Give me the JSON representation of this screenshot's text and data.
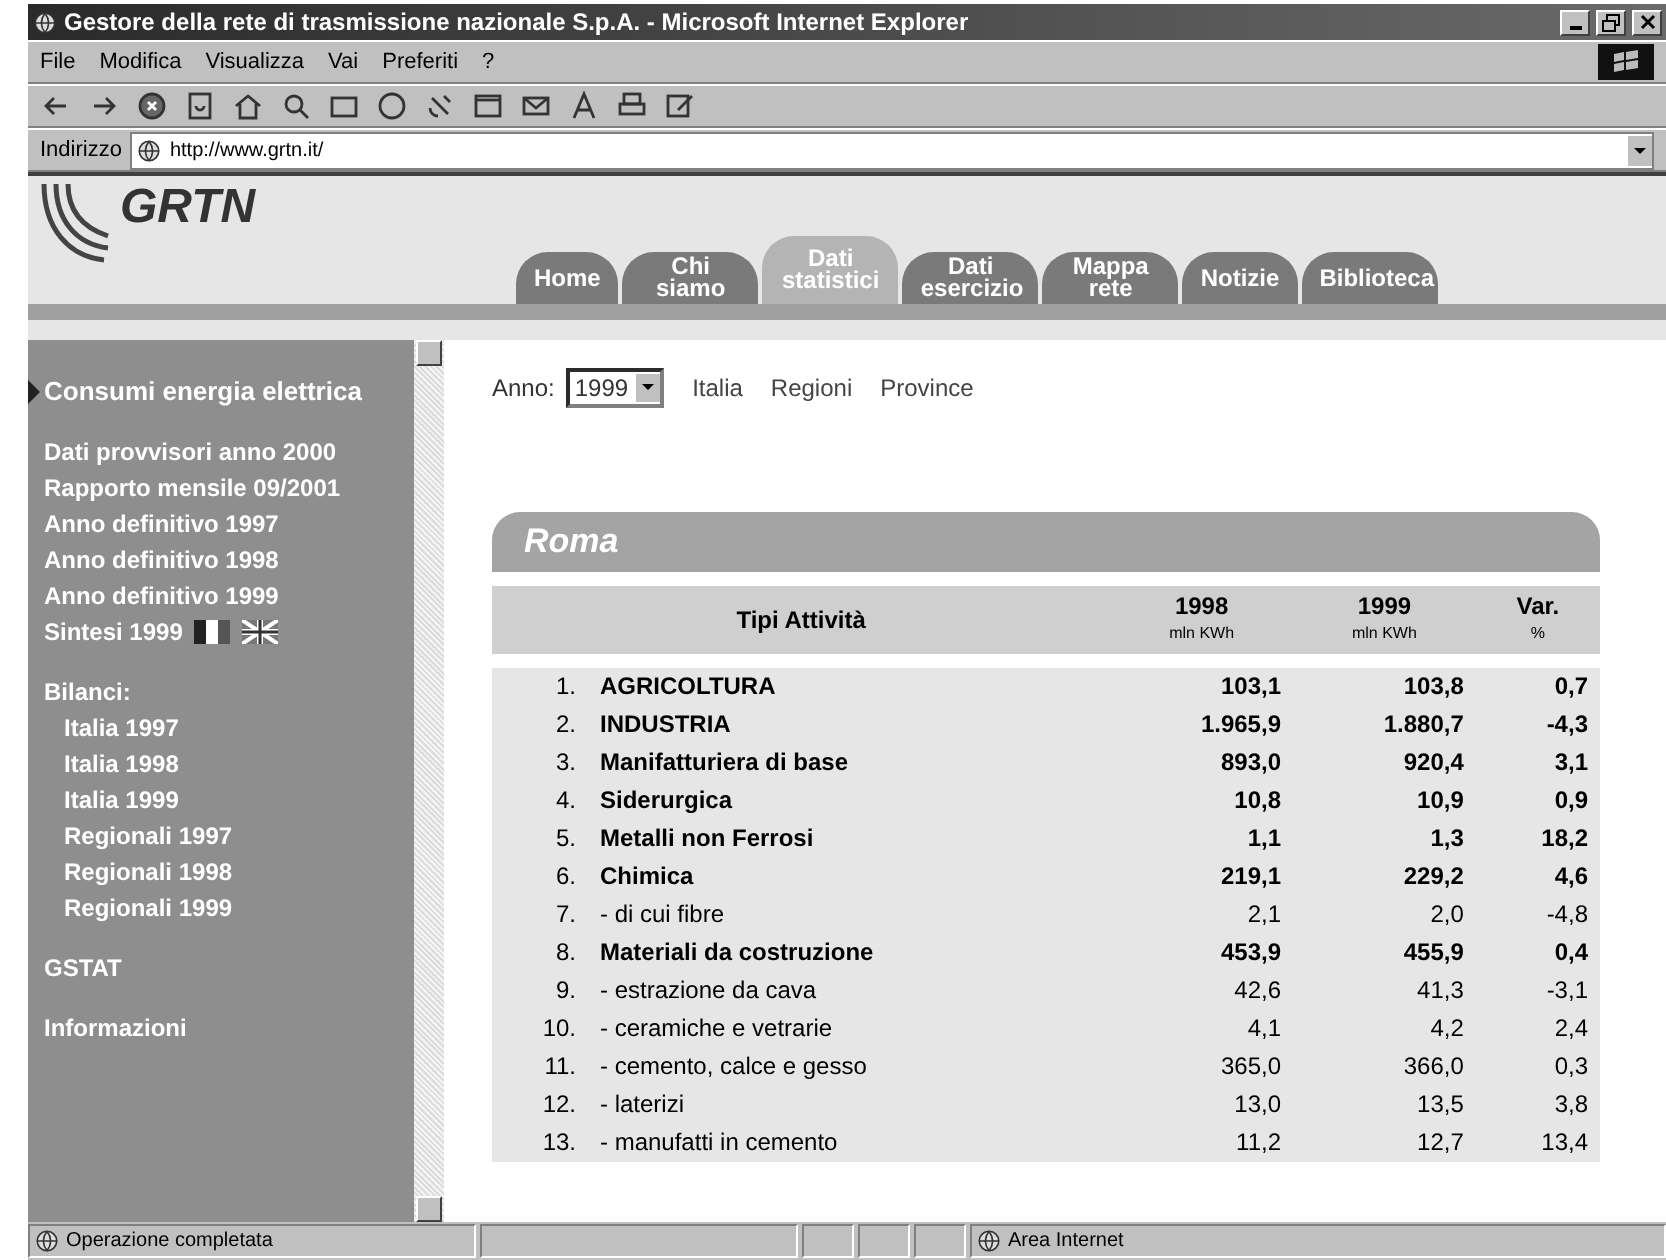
{
  "window": {
    "title": "Gestore della rete di trasmissione nazionale S.p.A. - Microsoft Internet Explorer"
  },
  "menu": [
    "File",
    "Modifica",
    "Visualizza",
    "Vai",
    "Preferiti",
    "?"
  ],
  "address": {
    "label": "Indirizzo",
    "value": "http://www.grtn.it/"
  },
  "site": {
    "logo": "GRTN",
    "tabs": [
      {
        "label": "Home",
        "selected": false
      },
      {
        "label": "Chi siamo",
        "selected": false
      },
      {
        "label": "Dati statistici",
        "selected": true
      },
      {
        "label": "Dati esercizio",
        "selected": false
      },
      {
        "label": "Mappa rete",
        "selected": false
      },
      {
        "label": "Notizie",
        "selected": false
      },
      {
        "label": "Biblioteca",
        "selected": false
      }
    ]
  },
  "sidebar": {
    "groups": [
      {
        "items": [
          {
            "label": "Consumi energia elettrica",
            "selected": true,
            "indented": false
          }
        ]
      },
      {
        "items": [
          {
            "label": "Dati provvisori anno 2000",
            "selected": false,
            "indented": false
          },
          {
            "label": "Rapporto mensile 09/2001",
            "selected": false,
            "indented": false
          },
          {
            "label": "Anno definitivo 1997",
            "selected": false,
            "indented": false
          },
          {
            "label": "Anno definitivo 1998",
            "selected": false,
            "indented": false
          },
          {
            "label": "Anno definitivo 1999",
            "selected": false,
            "indented": false
          },
          {
            "label": "Sintesi 1999",
            "selected": false,
            "indented": false,
            "flags": true
          }
        ]
      },
      {
        "items": [
          {
            "label": "Bilanci:",
            "selected": false,
            "indented": false
          },
          {
            "label": "Italia 1997",
            "selected": false,
            "indented": true
          },
          {
            "label": "Italia 1998",
            "selected": false,
            "indented": true
          },
          {
            "label": "Italia 1999",
            "selected": false,
            "indented": true
          },
          {
            "label": "Regionali 1997",
            "selected": false,
            "indented": true
          },
          {
            "label": "Regionali 1998",
            "selected": false,
            "indented": true
          },
          {
            "label": "Regionali 1999",
            "selected": false,
            "indented": true
          }
        ]
      },
      {
        "items": [
          {
            "label": "GSTAT",
            "selected": false,
            "indented": false
          }
        ]
      },
      {
        "items": [
          {
            "label": "Informazioni",
            "selected": false,
            "indented": false
          }
        ]
      }
    ]
  },
  "filter": {
    "label": "Anno:",
    "year": "1999",
    "links": [
      "Italia",
      "Regioni",
      "Province"
    ]
  },
  "table": {
    "title": "Roma",
    "columns": [
      {
        "label": "Tipi Attività"
      },
      {
        "label": "1998",
        "unit": "mln KWh"
      },
      {
        "label": "1999",
        "unit": "mln KWh"
      },
      {
        "label": "Var.",
        "unit": "%"
      }
    ],
    "rows": [
      {
        "num": "1.",
        "label": "AGRICOLTURA",
        "bold": true,
        "v1998": "103,1",
        "v1999": "103,8",
        "var": "0,7"
      },
      {
        "num": "2.",
        "label": "INDUSTRIA",
        "bold": true,
        "v1998": "1.965,9",
        "v1999": "1.880,7",
        "var": "-4,3"
      },
      {
        "num": "3.",
        "label": "Manifatturiera di base",
        "bold": true,
        "v1998": "893,0",
        "v1999": "920,4",
        "var": "3,1"
      },
      {
        "num": "4.",
        "label": "Siderurgica",
        "bold": true,
        "v1998": "10,8",
        "v1999": "10,9",
        "var": "0,9"
      },
      {
        "num": "5.",
        "label": "Metalli non Ferrosi",
        "bold": true,
        "v1998": "1,1",
        "v1999": "1,3",
        "var": "18,2"
      },
      {
        "num": "6.",
        "label": "Chimica",
        "bold": true,
        "v1998": "219,1",
        "v1999": "229,2",
        "var": "4,6"
      },
      {
        "num": "7.",
        "label": "- di cui fibre",
        "bold": false,
        "v1998": "2,1",
        "v1999": "2,0",
        "var": "-4,8"
      },
      {
        "num": "8.",
        "label": "Materiali da costruzione",
        "bold": true,
        "v1998": "453,9",
        "v1999": "455,9",
        "var": "0,4"
      },
      {
        "num": "9.",
        "label": "- estrazione da cava",
        "bold": false,
        "v1998": "42,6",
        "v1999": "41,3",
        "var": "-3,1"
      },
      {
        "num": "10.",
        "label": "- ceramiche e vetrarie",
        "bold": false,
        "v1998": "4,1",
        "v1999": "4,2",
        "var": "2,4"
      },
      {
        "num": "11.",
        "label": "- cemento, calce e gesso",
        "bold": false,
        "v1998": "365,0",
        "v1999": "366,0",
        "var": "0,3"
      },
      {
        "num": "12.",
        "label": "- laterizi",
        "bold": false,
        "v1998": "13,0",
        "v1999": "13,5",
        "var": "3,8"
      },
      {
        "num": "13.",
        "label": "- manufatti in cemento",
        "bold": false,
        "v1998": "11,2",
        "v1999": "12,7",
        "var": "13,4"
      }
    ]
  },
  "status_bar": {
    "message": "Operazione completata",
    "zone": "Area Internet"
  }
}
